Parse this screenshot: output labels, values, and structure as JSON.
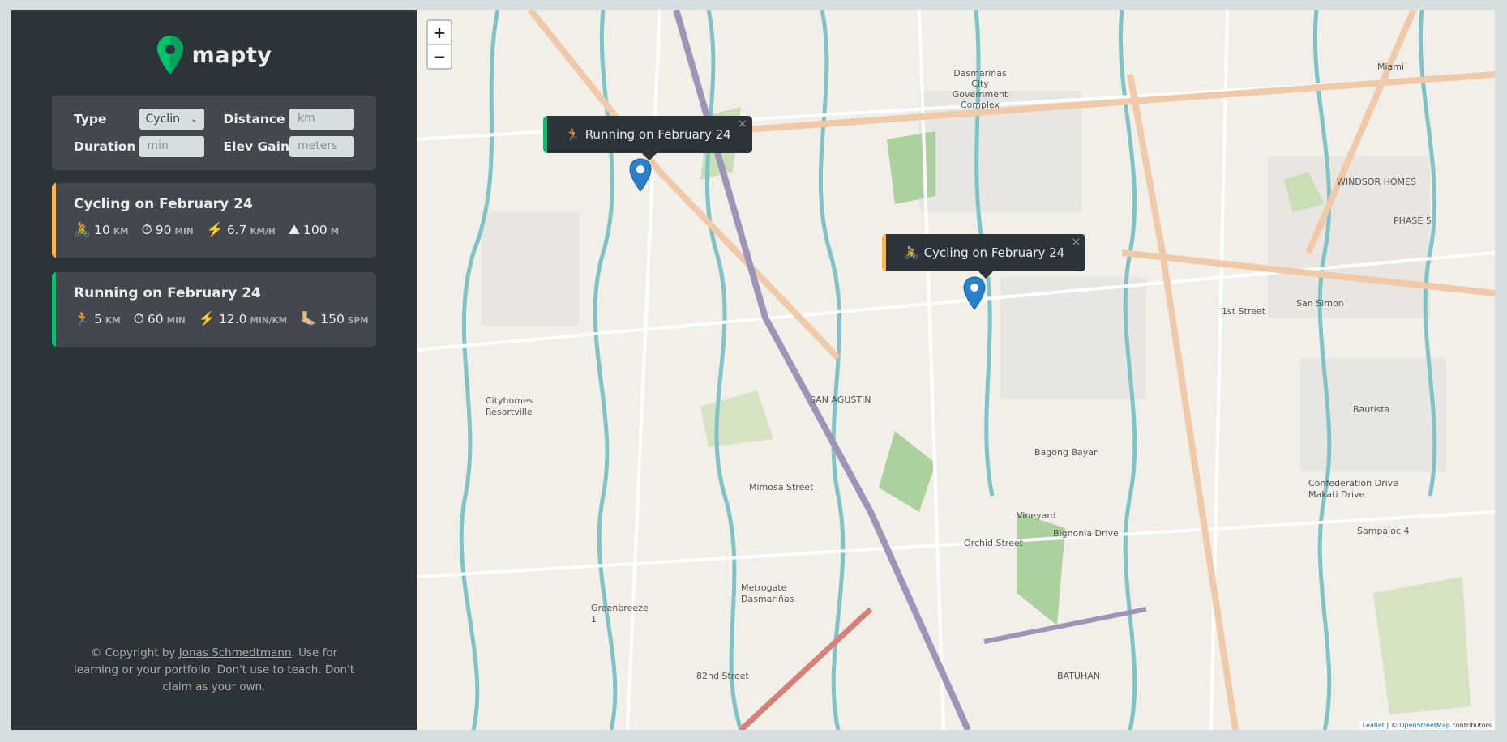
{
  "app": {
    "name": "mapty"
  },
  "form": {
    "type_label": "Type",
    "type_value": "Cyclin",
    "distance_label": "Distance",
    "distance_placeholder": "km",
    "duration_label": "Duration",
    "duration_placeholder": "min",
    "elev_label": "Elev Gain",
    "elev_placeholder": "meters"
  },
  "workouts": [
    {
      "title": "Cycling on February 24",
      "type": "cycling",
      "details": [
        {
          "icon": "🚴",
          "value": "10",
          "unit": "km"
        },
        {
          "icon": "⏱",
          "value": "90",
          "unit": "min"
        },
        {
          "icon": "⚡️",
          "value": "6.7",
          "unit": "km/h"
        },
        {
          "icon": "⛰",
          "value": "100",
          "unit": "m"
        }
      ]
    },
    {
      "title": "Running on February 24",
      "type": "running",
      "details": [
        {
          "icon": "🏃",
          "value": "5",
          "unit": "km"
        },
        {
          "icon": "⏱",
          "value": "60",
          "unit": "min"
        },
        {
          "icon": "⚡️",
          "value": "12.0",
          "unit": "min/km"
        },
        {
          "icon": "🦶🏼",
          "value": "150",
          "unit": "spm"
        }
      ]
    }
  ],
  "copyright": {
    "prefix": "© Copyright by ",
    "author": "Jonas Schmedtmann",
    "suffix": ". Use for learning or your portfolio. Don't use to teach. Don't claim as your own."
  },
  "map": {
    "zoom_in": "+",
    "zoom_out": "−",
    "popups": [
      {
        "icon": "🏃",
        "text": "Running on February 24",
        "close": "×"
      },
      {
        "icon": "🚴",
        "text": "Cycling on February 24",
        "close": "×"
      }
    ],
    "attribution": {
      "leaflet": "Leaflet",
      "sep": " | © ",
      "osm": "OpenStreetMap",
      "suffix": " contributors"
    },
    "labels": {
      "l1": "SAN AGUSTIN",
      "l2": "WINDSOR HOMES",
      "l3": "Bautista",
      "l4": "BATUHAN",
      "l5": "Dasmariñas City Government Complex",
      "l6": "Cityhomes Resortville",
      "l7": "Metrogate Dasmariñas",
      "l8": "Greenbreeze 1",
      "l9": "PHASE 5",
      "l10": "1st Street",
      "l11": "Orchid Street",
      "l12": "Mimosa Street",
      "l13": "Bignonia Drive",
      "l14": "Confederation Drive Makati Drive",
      "l15": "Miami",
      "l16": "San Simon",
      "l17": "Bagong Bayan",
      "l18": "Sampaloc 4",
      "l19": "82nd Street",
      "l20": "Vineyard"
    }
  },
  "colors": {
    "sidebar": "#2d3439",
    "card": "#42484d",
    "cycling": "#ffb545",
    "running": "#00c46a",
    "logo": "#00c46a"
  }
}
